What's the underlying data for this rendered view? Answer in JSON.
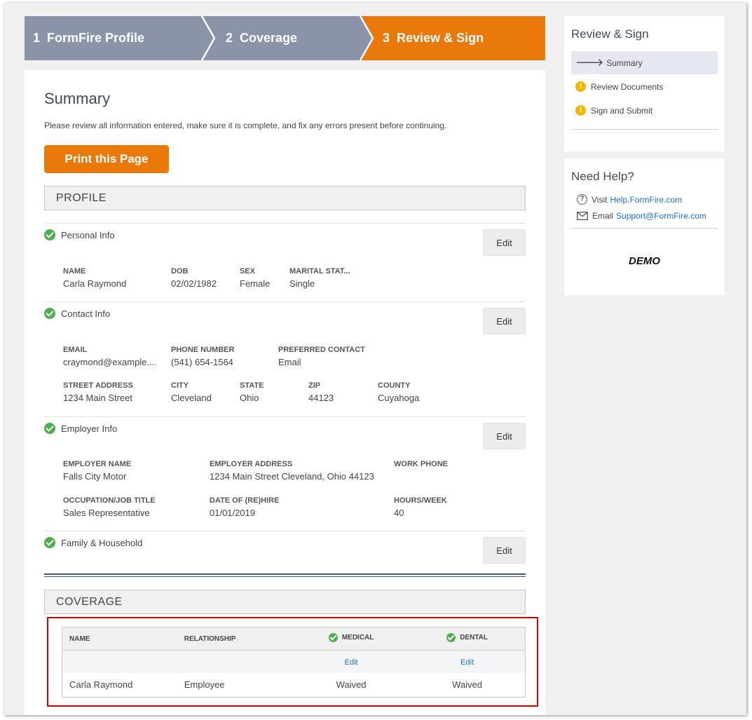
{
  "steps": [
    {
      "number": "1",
      "label": "FormFire Profile"
    },
    {
      "number": "2",
      "label": "Coverage"
    },
    {
      "number": "3",
      "label": "Review & Sign"
    }
  ],
  "summary": {
    "title": "Summary",
    "description": "Please review all information entered, make sure it is complete, and fix any errors present before continuing.",
    "print_label": "Print this Page"
  },
  "profile": {
    "section_title": "PROFILE",
    "edit_label": "Edit",
    "personal": {
      "title": "Personal Info",
      "fields": [
        {
          "label": "NAME",
          "value": "Carla Raymond"
        },
        {
          "label": "DOB",
          "value": "02/02/1982"
        },
        {
          "label": "SEX",
          "value": "Female"
        },
        {
          "label": "MARITAL STAT...",
          "value": "Single"
        }
      ]
    },
    "contact": {
      "title": "Contact Info",
      "fields": [
        {
          "label": "EMAIL",
          "value": "craymond@example...."
        },
        {
          "label": "PHONE NUMBER",
          "value": "(541) 654-1564"
        },
        {
          "label": "PREFERRED CONTACT",
          "value": "Email"
        },
        {
          "label": "STREET ADDRESS",
          "value": "1234 Main Street"
        },
        {
          "label": "CITY",
          "value": "Cleveland"
        },
        {
          "label": "STATE",
          "value": "Ohio"
        },
        {
          "label": "ZIP",
          "value": "44123"
        },
        {
          "label": "COUNTY",
          "value": "Cuyahoga"
        }
      ]
    },
    "employer": {
      "title": "Employer Info",
      "fields": [
        {
          "label": "EMPLOYER NAME",
          "value": "Falls City Motor"
        },
        {
          "label": "EMPLOYER ADDRESS",
          "value": "1234 Main Street Cleveland, Ohio 44123"
        },
        {
          "label": "WORK PHONE",
          "value": ""
        },
        {
          "label": "OCCUPATION/JOB TITLE",
          "value": "Sales Representative"
        },
        {
          "label": "DATE OF (RE)HIRE",
          "value": "01/01/2019"
        },
        {
          "label": "HOURS/WEEK",
          "value": "40"
        }
      ]
    },
    "family": {
      "title": "Family & Household"
    }
  },
  "coverage": {
    "section_title": "COVERAGE",
    "headers": {
      "name": "NAME",
      "relationship": "RELATIONSHIP",
      "medical": "MEDICAL",
      "dental": "DENTAL"
    },
    "edit_label": "Edit",
    "rows": [
      {
        "name": "Carla Raymond",
        "relationship": "Employee",
        "medical": "Waived",
        "dental": "Waived"
      }
    ]
  },
  "sidebar": {
    "review": {
      "title": "Review & Sign",
      "items": [
        {
          "label": "Summary",
          "icon": "arrow-right-icon",
          "active": true
        },
        {
          "label": "Review Documents",
          "icon": "warning-icon"
        },
        {
          "label": "Sign and Submit",
          "icon": "warning-icon"
        }
      ]
    },
    "help": {
      "title": "Need Help?",
      "visit_prefix": "Visit",
      "visit_link": "Help.FormFire.com",
      "email_prefix": "Email",
      "email_link": "Support@FormFire.com",
      "badge": "DEMO"
    }
  },
  "colors": {
    "accent": "#e8790a",
    "step_inactive": "#8a93a8",
    "success": "#4cae4c",
    "warning": "#f4b400",
    "link": "#1f6fd1",
    "highlight": "#d00000"
  }
}
